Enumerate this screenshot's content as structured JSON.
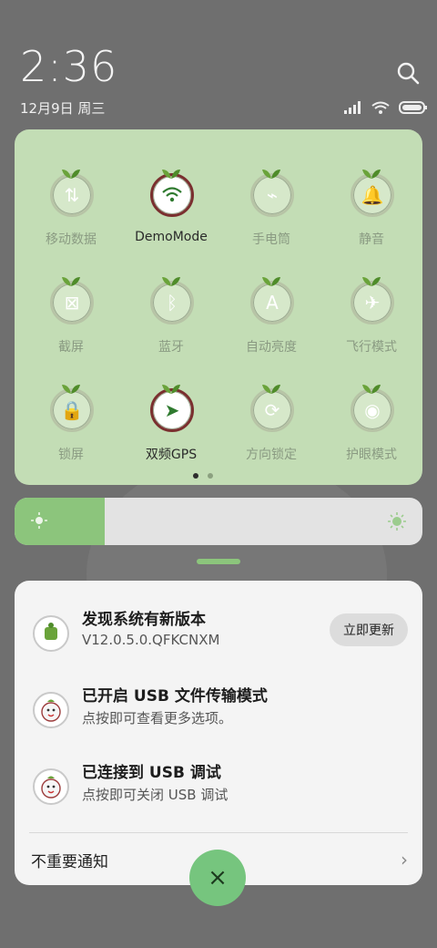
{
  "status": {
    "time": "2:36",
    "date": "12月9日 周三"
  },
  "tiles": [
    {
      "label": "移动数据",
      "icon": "mobile-data-icon",
      "state": "off"
    },
    {
      "label": "DemoMode",
      "icon": "wifi-icon",
      "state": "on"
    },
    {
      "label": "手电筒",
      "icon": "flashlight-icon",
      "state": "off"
    },
    {
      "label": "静音",
      "icon": "bell-icon",
      "state": "off"
    },
    {
      "label": "截屏",
      "icon": "screenshot-icon",
      "state": "off"
    },
    {
      "label": "蓝牙",
      "icon": "bluetooth-icon",
      "state": "off"
    },
    {
      "label": "自动亮度",
      "icon": "auto-brightness-icon",
      "state": "off"
    },
    {
      "label": "飞行模式",
      "icon": "airplane-icon",
      "state": "off"
    },
    {
      "label": "锁屏",
      "icon": "lock-icon",
      "state": "off"
    },
    {
      "label": "双频GPS",
      "icon": "gps-icon",
      "state": "on"
    },
    {
      "label": "方向锁定",
      "icon": "rotation-lock-icon",
      "state": "off"
    },
    {
      "label": "护眼模式",
      "icon": "eye-icon",
      "state": "off"
    }
  ],
  "brightness": {
    "level": 0.22
  },
  "notifications": [
    {
      "title": "发现系统有新版本",
      "subtitle": "V12.0.5.0.QFKCNXM",
      "action": "立即更新"
    },
    {
      "title": "已开启 USB 文件传输模式",
      "subtitle": "点按即可查看更多选项。"
    },
    {
      "title": "已连接到 USB 调试",
      "subtitle": "点按即可关闭 USB 调试"
    }
  ],
  "footer": {
    "unimportant_label": "不重要通知",
    "close_glyph": "×"
  },
  "colors": {
    "accent": "#76c57e",
    "panel": "#c3ddb5",
    "card": "#f4f4f4"
  }
}
